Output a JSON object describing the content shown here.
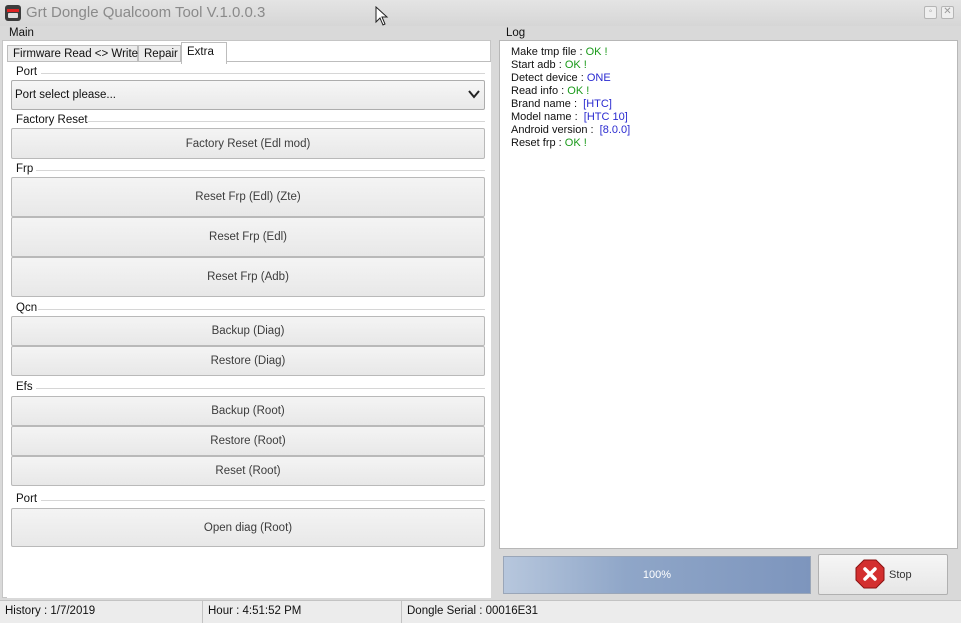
{
  "window": {
    "title": "Grt Dongle Qualcoom Tool V.1.0.0.3",
    "minimize_glyph": "◦",
    "close_glyph": "✕"
  },
  "main": {
    "label": "Main",
    "tabs": [
      "Firmware Read <> Write",
      "Repair",
      "Extra"
    ],
    "active_tab": "Extra",
    "port": {
      "group_label": "Port",
      "select_value": "Port select please..."
    },
    "factory_reset": {
      "group_label": "Factory Reset",
      "buttons": [
        "Factory Reset (Edl mod)"
      ]
    },
    "frp": {
      "group_label": "Frp",
      "buttons": [
        "Reset Frp (Edl) (Zte)",
        "Reset Frp (Edl)",
        "Reset Frp (Adb)"
      ]
    },
    "qcn": {
      "group_label": "Qcn",
      "buttons": [
        "Backup (Diag)",
        "Restore (Diag)"
      ]
    },
    "efs": {
      "group_label": "Efs",
      "buttons": [
        "Backup (Root)",
        "Restore (Root)",
        "Reset (Root)"
      ]
    },
    "port2": {
      "group_label": "Port",
      "buttons": [
        "Open diag (Root)"
      ]
    }
  },
  "log": {
    "label": "Log",
    "lines": [
      {
        "key": "Make tmp file : ",
        "value": "OK !",
        "kind": "ok"
      },
      {
        "key": "Start adb : ",
        "value": "OK !",
        "kind": "ok"
      },
      {
        "key": "Detect device : ",
        "value": "ONE",
        "kind": "val"
      },
      {
        "key": "Read info : ",
        "value": "OK !",
        "kind": "ok"
      },
      {
        "key": "Brand name :  ",
        "value": "[HTC]",
        "kind": "val"
      },
      {
        "key": "Model name :  ",
        "value": "[HTC 10]",
        "kind": "val"
      },
      {
        "key": "Android version :  ",
        "value": "[8.0.0]",
        "kind": "val"
      },
      {
        "key": "Reset frp : ",
        "value": "OK !",
        "kind": "ok"
      }
    ]
  },
  "progress": {
    "value": 1.0,
    "label": "100%"
  },
  "stop_button": {
    "label": "Stop",
    "icon": "stop-x-icon",
    "icon_color": "#d32f2f"
  },
  "status": {
    "history": "History : 1/7/2019",
    "hour": "Hour  : 4:51:52 PM",
    "dongle_serial": "Dongle Serial : 00016E31"
  },
  "colors": {
    "ok": "#1a9a1a",
    "value": "#2a2ad0",
    "progress": "#7d95bd"
  }
}
